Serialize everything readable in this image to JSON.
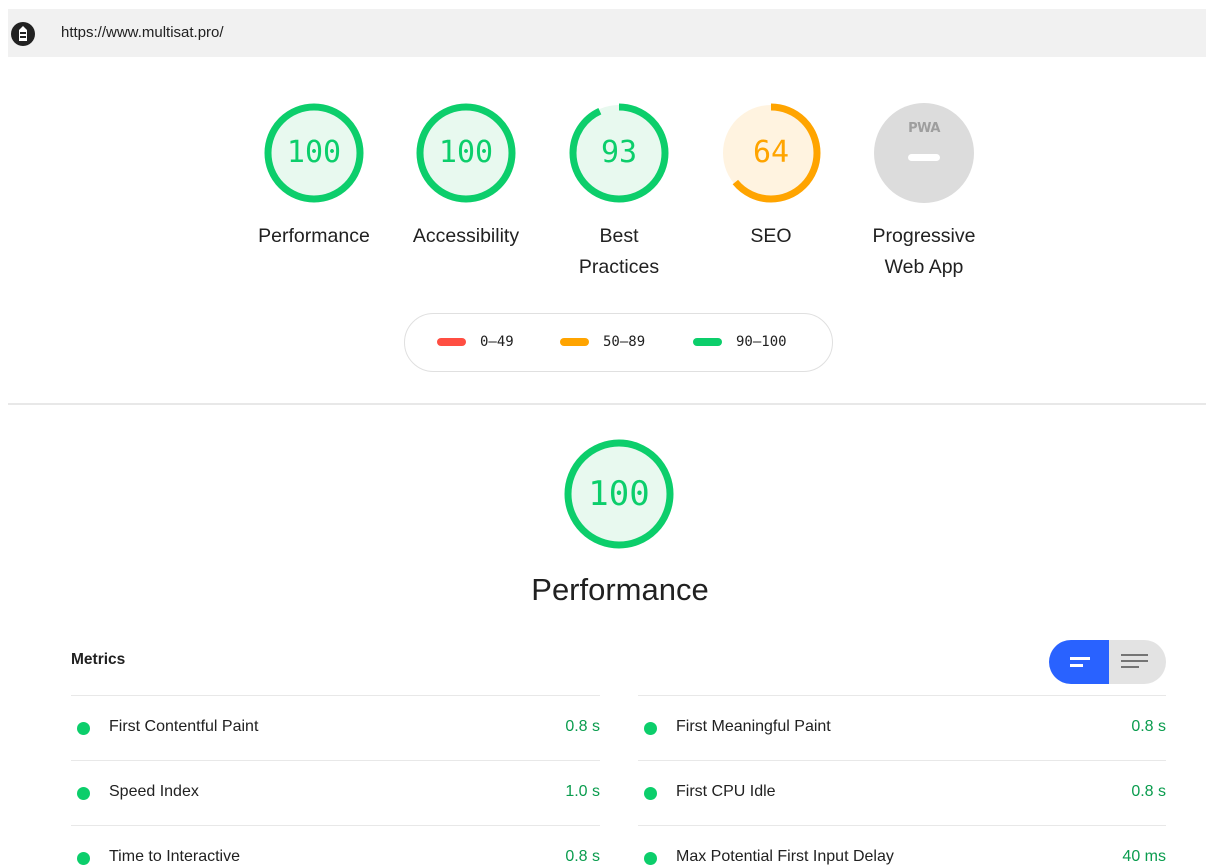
{
  "header": {
    "url": "https://www.multisat.pro/",
    "site_icon": "lighthouse-site-icon"
  },
  "categories": [
    {
      "label": "Performance",
      "score": "100",
      "fraction": 1.0,
      "color": "#0cce6b"
    },
    {
      "label": "Accessibility",
      "score": "100",
      "fraction": 1.0,
      "color": "#0cce6b"
    },
    {
      "label": "Best Practices",
      "score": "93",
      "fraction": 0.93,
      "color": "#0cce6b"
    },
    {
      "label": "SEO",
      "score": "64",
      "fraction": 0.64,
      "color": "#ffa400"
    },
    {
      "label": "Progressive Web App",
      "badge": "PWA",
      "color": "#bdbdbd"
    }
  ],
  "legend": [
    {
      "range": "0–49",
      "color": "#ff4e42"
    },
    {
      "range": "50–89",
      "color": "#ffa400"
    },
    {
      "range": "90–100",
      "color": "#0cce6b"
    }
  ],
  "performance": {
    "score": "100",
    "fraction": 1.0,
    "title": "Performance"
  },
  "metrics": {
    "title": "Metrics",
    "toggle": {
      "active": "compact-view-icon",
      "inactive": "expanded-view-icon",
      "active_color": "#2962ff"
    },
    "left": [
      {
        "name": "First Contentful Paint",
        "value": "0.8 s"
      },
      {
        "name": "Speed Index",
        "value": "1.0 s"
      },
      {
        "name": "Time to Interactive",
        "value": "0.8 s"
      }
    ],
    "right": [
      {
        "name": "First Meaningful Paint",
        "value": "0.8 s"
      },
      {
        "name": "First CPU Idle",
        "value": "0.8 s"
      },
      {
        "name": "Max Potential First Input Delay",
        "value": "40 ms"
      }
    ]
  }
}
